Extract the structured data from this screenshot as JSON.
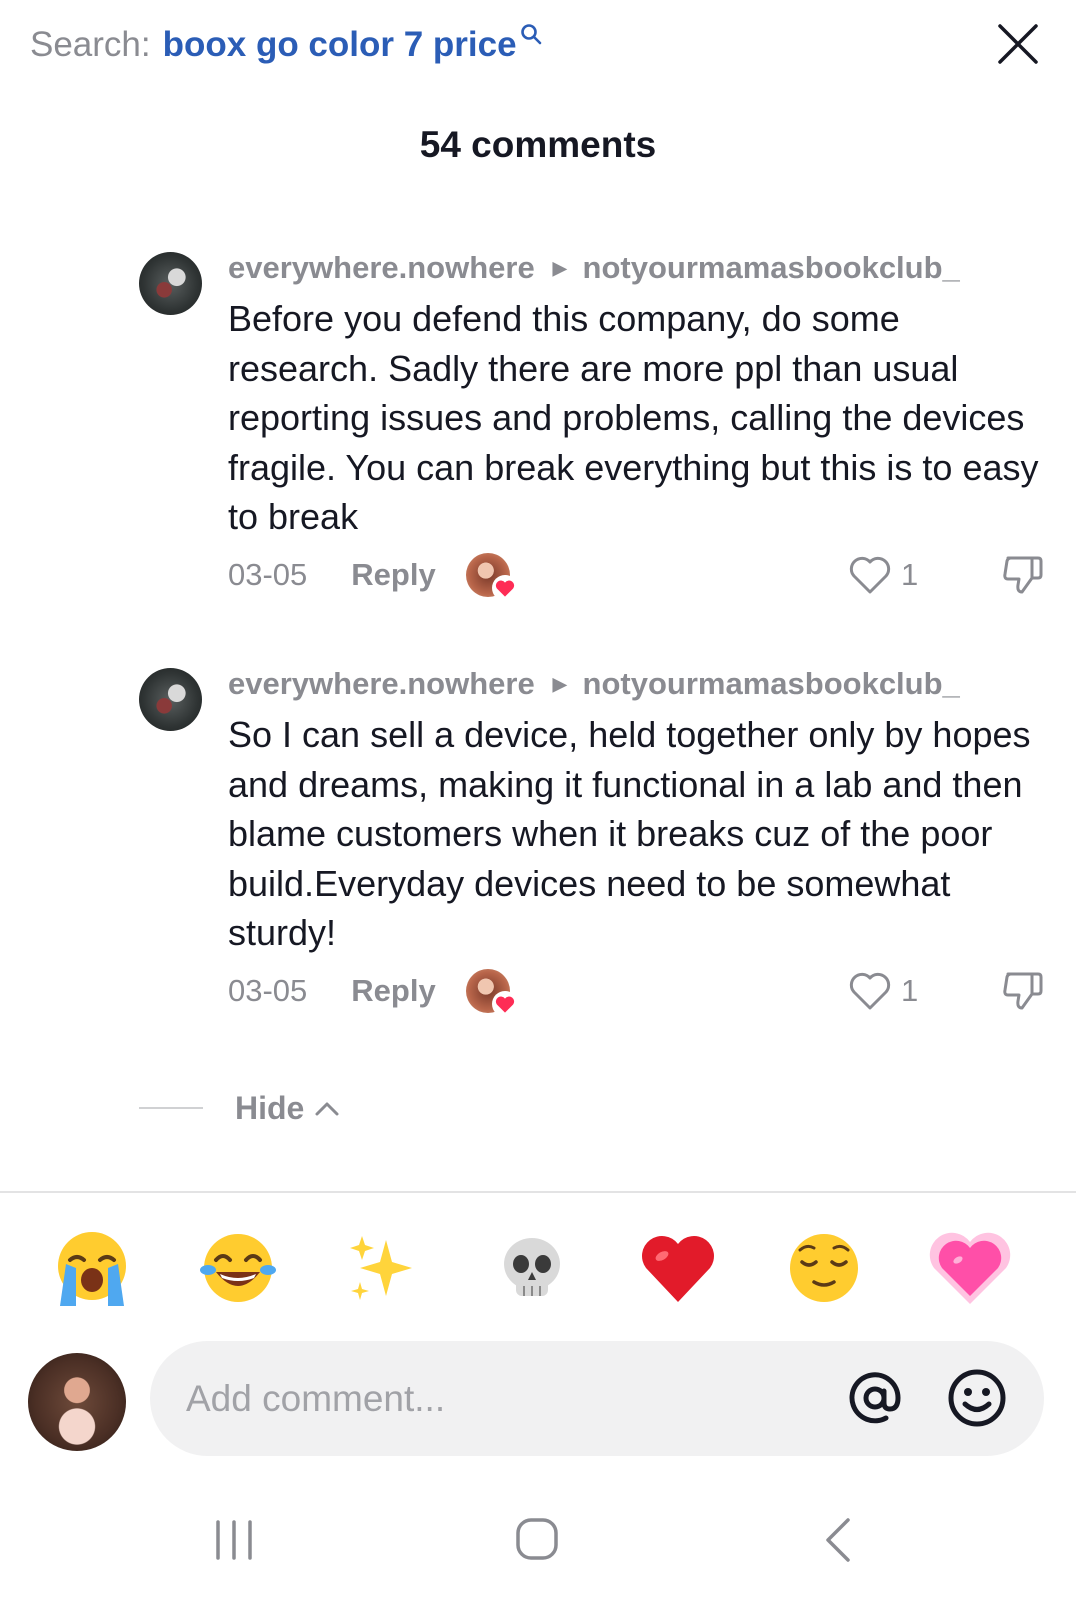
{
  "search": {
    "prefix": "Search:",
    "query": "boox go color 7 price"
  },
  "header": {
    "comment_count": "54 comments"
  },
  "comments": [
    {
      "author": "everywhere.nowhere",
      "reply_to": "notyourmamasbookclub_",
      "text": "Before you defend this company, do some research. Sadly there are more ppl than usual reporting issues and problems, calling the devices fragile. You can break everything but this is to easy to break",
      "date": "03-05",
      "reply_label": "Reply",
      "likes": "1"
    },
    {
      "author": "everywhere.nowhere",
      "reply_to": "notyourmamasbookclub_",
      "text": "So I can sell a device, held together only by hopes and dreams, making it functional in a lab and then blame customers when it breaks cuz of the poor build.Everyday devices need to be somewhat sturdy!",
      "date": "03-05",
      "reply_label": "Reply",
      "likes": "1"
    }
  ],
  "thread": {
    "hide_label": "Hide"
  },
  "quick_emojis": [
    "loudly-crying-face",
    "face-with-tears-of-joy",
    "sparkles",
    "skull",
    "red-heart",
    "relieved-face",
    "sparkling-heart"
  ],
  "composer": {
    "placeholder": "Add comment..."
  },
  "icons": {
    "search": "magnifier-icon",
    "close": "close-icon",
    "like": "heart-outline-icon",
    "dislike": "thumbs-down-icon",
    "mention": "at-icon",
    "emoji": "smiley-icon",
    "nav": [
      "recent-apps-icon",
      "home-icon",
      "back-icon"
    ]
  },
  "colors": {
    "accent": "#2b5db6",
    "muted": "#8a8b91",
    "text": "#161823",
    "heart": "#fe2c55"
  }
}
